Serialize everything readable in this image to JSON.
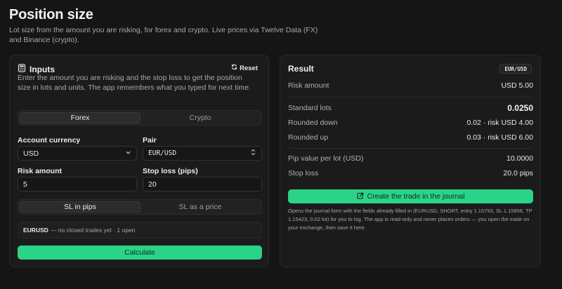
{
  "header": {
    "title": "Position size",
    "subtitle": "Lot size from the amount you are risking, for forex and crypto. Live prices via Twelve Data (FX) and Binance (crypto)."
  },
  "inputs": {
    "title": "Inputs",
    "reset_label": "Reset",
    "description": "Enter the amount you are risking and the stop loss to get the position size in lots and units. The app remembers what you typed for next time.",
    "market_tabs": [
      {
        "label": "Forex",
        "active": true
      },
      {
        "label": "Crypto",
        "active": false
      }
    ],
    "account_currency": {
      "label": "Account currency",
      "value": "USD"
    },
    "pair": {
      "label": "Pair",
      "value": "EUR/USD"
    },
    "risk_amount": {
      "label": "Risk amount",
      "value": "5"
    },
    "stop_loss": {
      "label": "Stop loss (pips)",
      "value": "20"
    },
    "sl_mode_tabs": [
      {
        "label": "SL in pips",
        "active": true
      },
      {
        "label": "SL as a price",
        "active": false
      }
    ],
    "hint": {
      "symbol": "EURUSD",
      "text": "— no closed trades yet · 1 open"
    },
    "calculate_label": "Calculate"
  },
  "result": {
    "title": "Result",
    "pair_badge": "EUR/USD",
    "risk_amount": {
      "label": "Risk amount",
      "value": "USD 5.00"
    },
    "standard_lots": {
      "label": "Standard lots",
      "value": "0.0250"
    },
    "rounded_down": {
      "label": "Rounded down",
      "value": "0.02 · risk USD 4.00"
    },
    "rounded_up": {
      "label": "Rounded up",
      "value": "0.03 · risk USD 6.00"
    },
    "pip_value": {
      "label": "Pip value per lot (USD)",
      "value": "10.0000"
    },
    "stop_loss": {
      "label": "Stop loss",
      "value": "20.0 pips"
    },
    "journal_button_label": "Create the trade in the journal",
    "journal_note": "Opens the journal form with the fields already filled in (EURUSD, SHORT, entry 1.15793, SL 1.15856, TP 1.15423, 0.02 lot) for you to log. The app is read-only and never places orders — you open the trade on your exchange, then save it here."
  },
  "colors": {
    "accent": "#2bd389",
    "background": "#151515",
    "panel": "#1b1b1b"
  },
  "icons": [
    "calculator-icon",
    "refresh-icon",
    "chevron-down-icon",
    "up-down-chevron-icon",
    "external-link-icon"
  ]
}
